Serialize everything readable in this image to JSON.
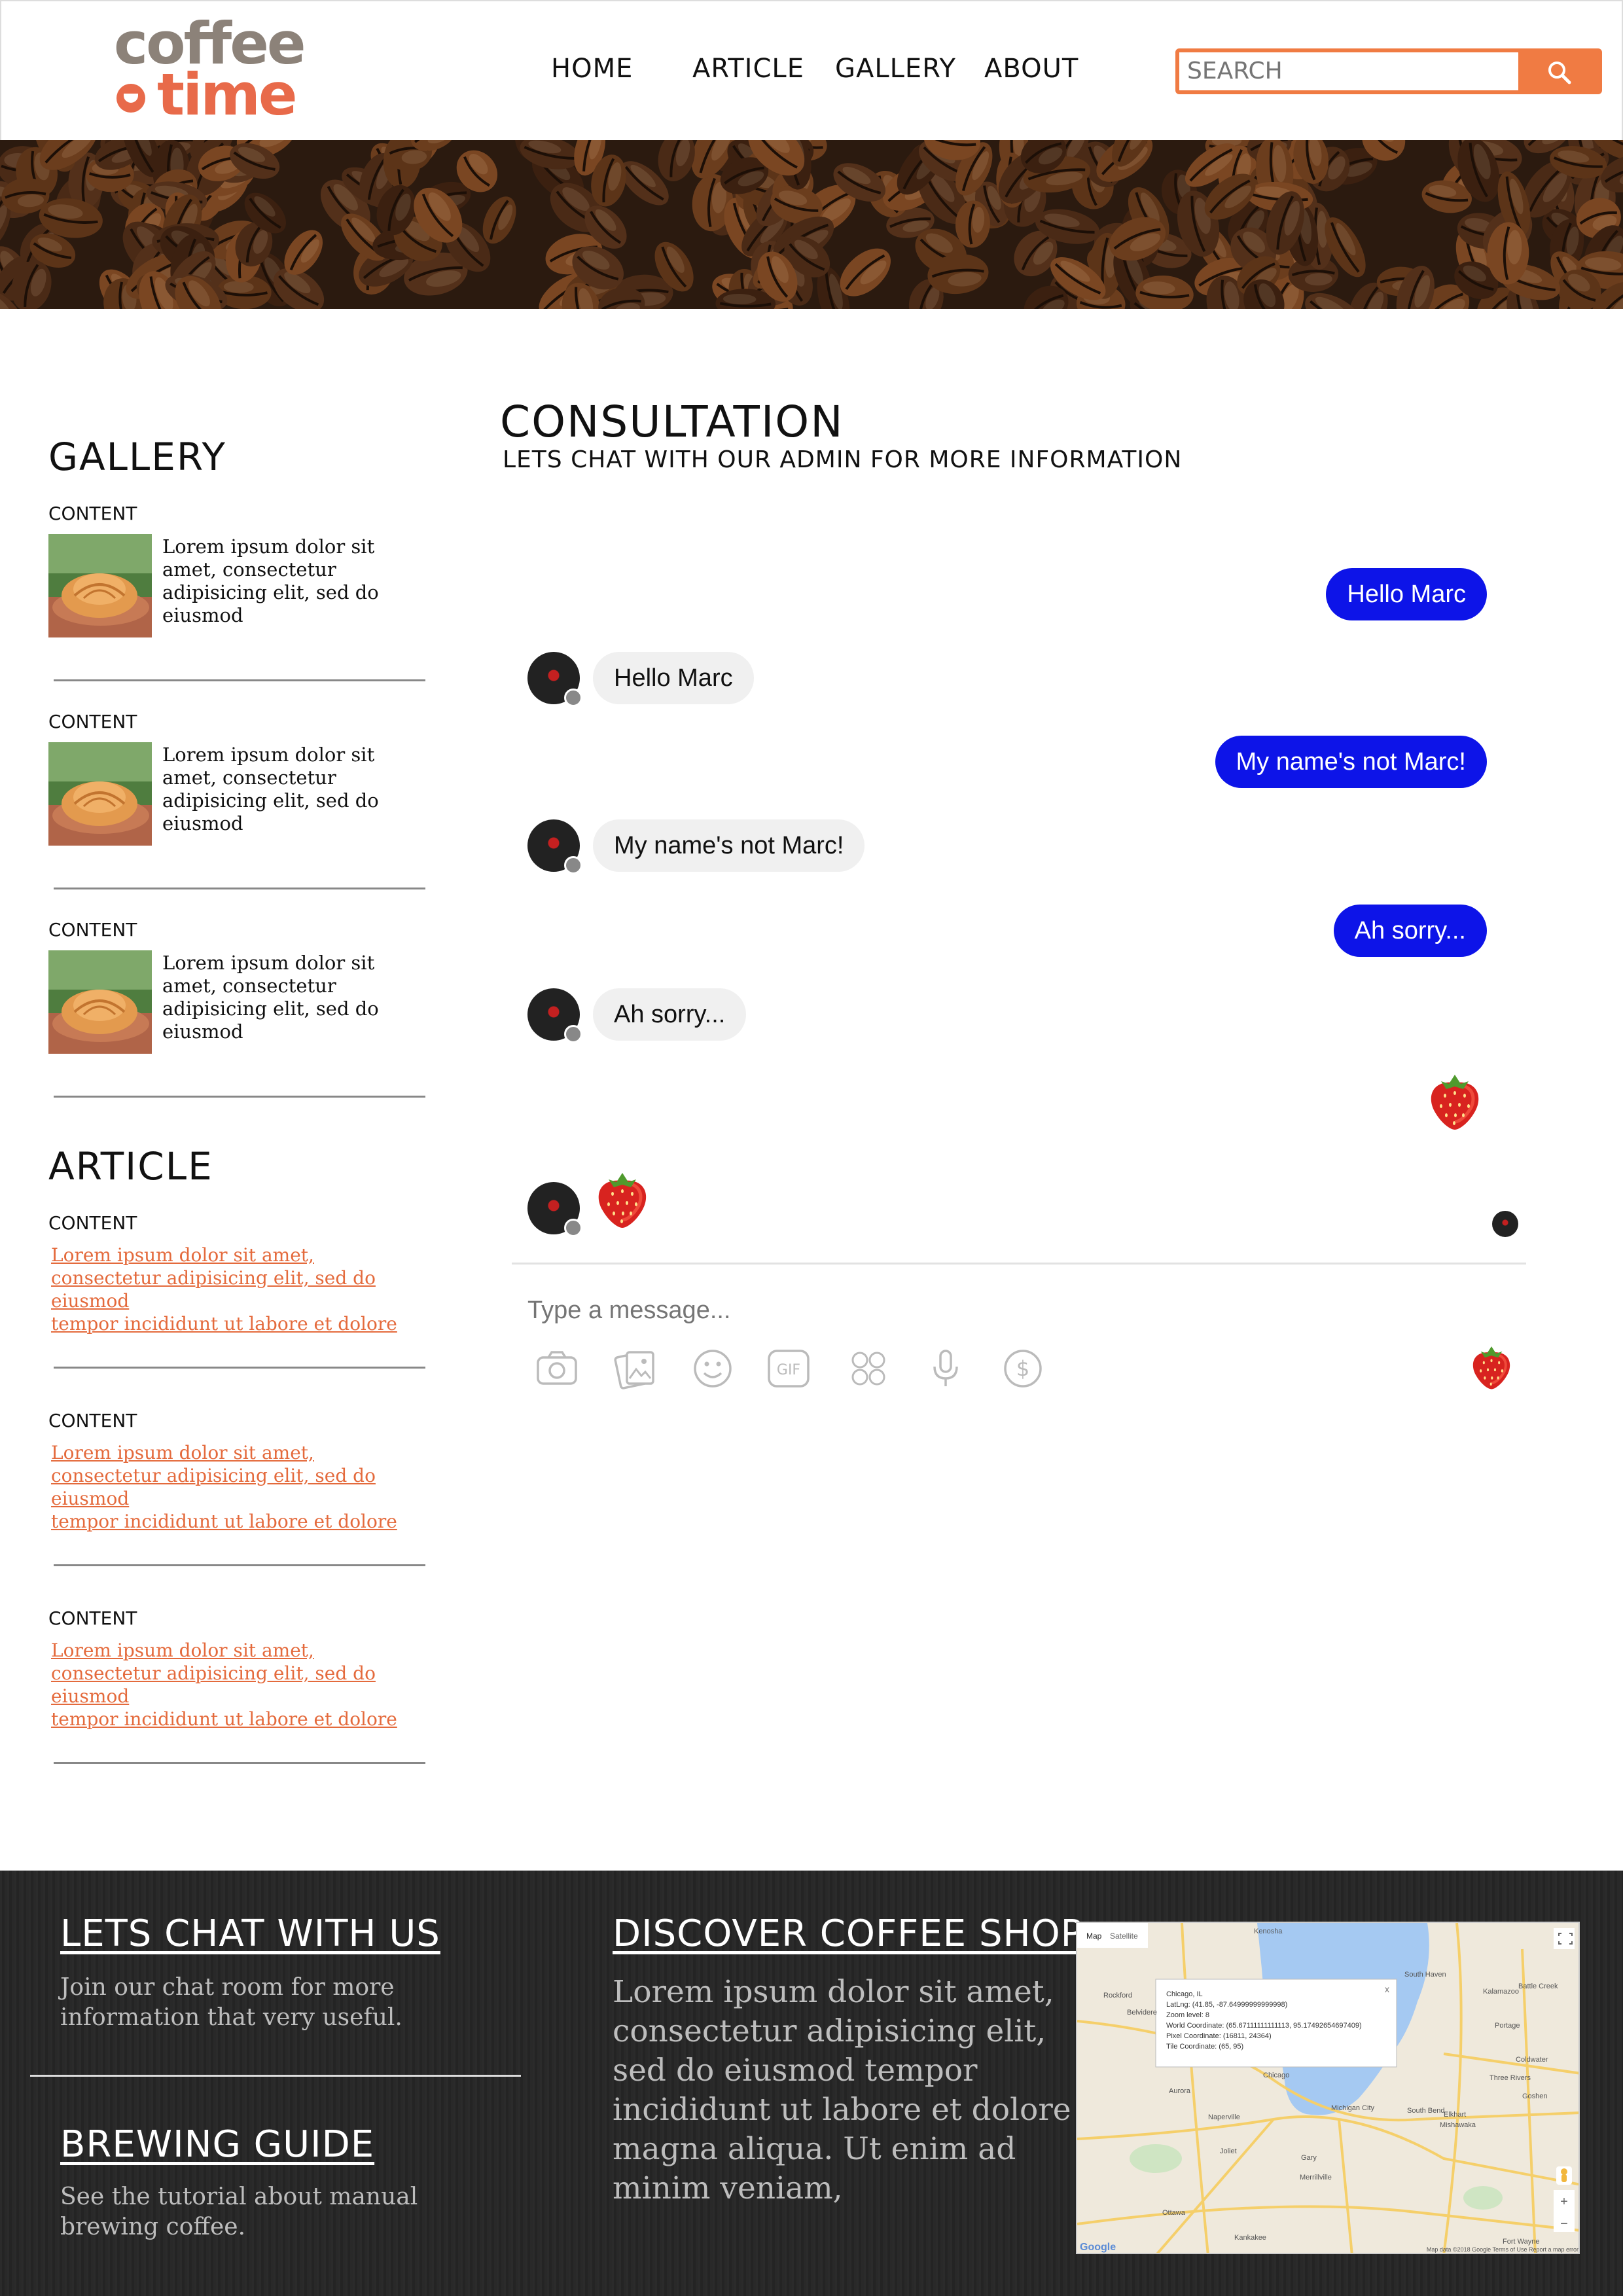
{
  "header": {
    "logo": {
      "line1": "coffee",
      "line2": "time"
    },
    "nav": [
      "HOME",
      "ARTICLE",
      "GALLERY",
      "ABOUT"
    ],
    "search": {
      "placeholder": "SEARCH",
      "button_icon": "search-icon"
    }
  },
  "colors": {
    "accent": "#f07b43",
    "brand_brown": "#8c8279",
    "brand_orange": "#e86a4a",
    "bubble_out": "#0d14e8",
    "bubble_in": "#f0f0f0",
    "link": "#e46a3c",
    "footer_bg": "#262626"
  },
  "sidebar": {
    "gallery_heading": "GALLERY",
    "gallery_items": [
      {
        "label": "CONTENT",
        "text": [
          "Lorem ipsum dolor sit",
          "amet, consectetur",
          "adipisicing  elit, sed do",
          "eiusmod"
        ]
      },
      {
        "label": "CONTENT",
        "text": [
          "Lorem ipsum dolor sit",
          "amet, consectetur",
          "adipisicing  elit, sed do",
          "eiusmod"
        ]
      },
      {
        "label": "CONTENT",
        "text": [
          "Lorem ipsum dolor sit",
          "amet, consectetur",
          "adipisicing  elit, sed do",
          "eiusmod"
        ]
      }
    ],
    "article_heading": "ARTICLE",
    "article_items": [
      {
        "label": "CONTENT",
        "links": [
          "Lorem ipsum dolor sit amet,",
          "consectetur adipisicing  elit, sed do",
          "eiusmod",
          "tempor incididunt ut labore et dolore"
        ]
      },
      {
        "label": "CONTENT",
        "links": [
          "Lorem ipsum dolor sit amet,",
          "consectetur adipisicing  elit, sed do",
          "eiusmod",
          "tempor incididunt ut labore et dolore"
        ]
      },
      {
        "label": "CONTENT",
        "links": [
          "Lorem ipsum dolor sit amet,",
          "consectetur adipisicing  elit, sed do",
          "eiusmod",
          "tempor incididunt ut labore et dolore"
        ]
      }
    ]
  },
  "chat": {
    "title": "CONSULTATION",
    "subtitle": "LETS CHAT WITH OUR ADMIN FOR MORE INFORMATION",
    "messages": [
      {
        "from": "me",
        "text": "Hello Marc"
      },
      {
        "from": "admin",
        "text": "Hello Marc"
      },
      {
        "from": "me",
        "text": "My name's not Marc!"
      },
      {
        "from": "admin",
        "text": "My name's not Marc!"
      },
      {
        "from": "me",
        "text": "Ah sorry..."
      },
      {
        "from": "admin",
        "text": "Ah sorry..."
      },
      {
        "from": "me",
        "emoji": "strawberry-icon"
      },
      {
        "from": "admin",
        "emoji": "strawberry-icon"
      }
    ],
    "input_placeholder": "Type a message...",
    "toolbar": [
      "camera-icon",
      "photo-icon",
      "emoji-icon",
      "gif-icon",
      "stickers-icon",
      "microphone-icon",
      "payment-icon"
    ],
    "toolbar_gif_label": "GIF",
    "send_icon": "strawberry-icon"
  },
  "footer": {
    "chat_heading": "LETS CHAT WITH US",
    "chat_text": [
      "Join our chat room for more",
      "information that very useful."
    ],
    "guide_heading": "BREWING GUIDE",
    "guide_text": [
      "See the tutorial about manual",
      "brewing coffee."
    ],
    "shop_heading": "DISCOVER COFFEE SHOP",
    "shop_text": [
      "Lorem ipsum dolor sit amet,",
      "consectetur adipisicing elit,",
      "sed do eiusmod tempor",
      "incididunt ut labore et dolore",
      "magna aliqua. Ut enim ad",
      "minim veniam,"
    ],
    "map": {
      "tabs": [
        "Map",
        "Satellite"
      ],
      "popup": [
        "Chicago, IL",
        "LatLng: (41.85, -87.64999999999998)",
        "Zoom level: 8",
        "World Coordinate: (65.67111111111113, 95.17492654697409)",
        "Pixel Coordinate: (16811, 24364)",
        "Tile Coordinate: (65, 95)"
      ],
      "popup_close": "x",
      "cities": [
        "Kenosha",
        "Rockford",
        "South Haven",
        "Kalamazoo",
        "Battle Creek",
        "Portage",
        "Coldwater",
        "Three Rivers",
        "Elkhart",
        "South Bend",
        "Mishawaka",
        "Goshen",
        "Naperville",
        "Chicago",
        "Gary",
        "Joliet",
        "Michigan City",
        "Ottawa",
        "Kankakee",
        "Merrillville",
        "Fort Wayne",
        "Aurora",
        "Belvidere"
      ],
      "logo": "Google",
      "attribution": "Map data ©2018 Google   Terms of Use   Report a map error"
    }
  }
}
